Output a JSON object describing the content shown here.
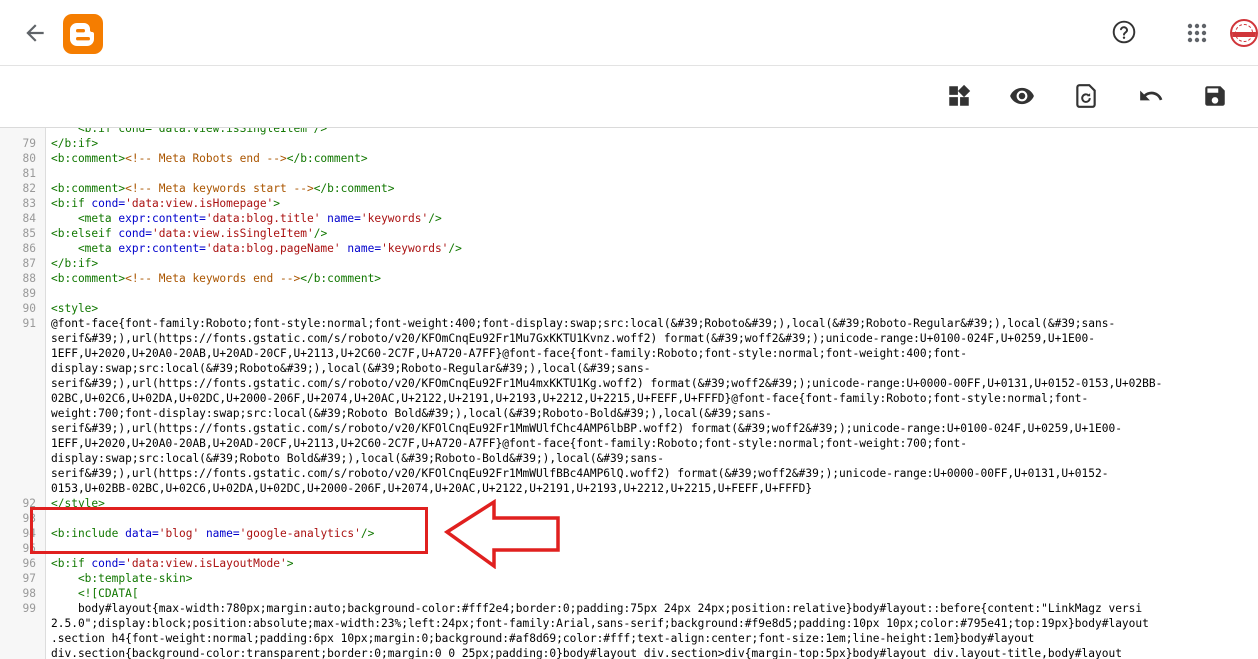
{
  "app": {
    "name": "Blogger",
    "brand_color": "#f57d00"
  },
  "header": {
    "back_icon": "arrow-left-icon",
    "help_icon": "help-circle-icon",
    "apps_icon": "apps-grid-icon",
    "avatar": "user-avatar"
  },
  "toolbar": {
    "buttons": [
      {
        "name": "jump-to-widget",
        "icon": "widgets-icon"
      },
      {
        "name": "preview-theme",
        "icon": "eye-icon"
      },
      {
        "name": "restore-theme",
        "icon": "restore-icon"
      },
      {
        "name": "undo",
        "icon": "undo-icon"
      },
      {
        "name": "save-theme",
        "icon": "save-icon"
      }
    ]
  },
  "highlight_color": "#e0201f",
  "code_lines": [
    {
      "n": "",
      "segs": [
        [
          "tag",
          "    <b:if cond='data:view.isSingleItem'/>"
        ]
      ]
    },
    {
      "n": "79",
      "segs": [
        [
          "tag",
          "</b:if>"
        ]
      ]
    },
    {
      "n": "80",
      "segs": [
        [
          "tag",
          "<b:comment>"
        ],
        [
          "com",
          "<!-- Meta Robots end -->"
        ],
        [
          "tag",
          "</b:comment>"
        ]
      ]
    },
    {
      "n": "81",
      "segs": [
        [
          "txt",
          ""
        ]
      ]
    },
    {
      "n": "82",
      "segs": [
        [
          "tag",
          "<b:comment>"
        ],
        [
          "com",
          "<!-- Meta keywords start -->"
        ],
        [
          "tag",
          "</b:comment>"
        ]
      ]
    },
    {
      "n": "83",
      "segs": [
        [
          "tag",
          "<b:if "
        ],
        [
          "attr",
          "cond="
        ],
        [
          "str",
          "'data:view.isHomepage'"
        ],
        [
          "tag",
          ">"
        ]
      ]
    },
    {
      "n": "84",
      "segs": [
        [
          "tag",
          "    <meta "
        ],
        [
          "attr",
          "expr:content="
        ],
        [
          "str",
          "'data:blog.title'"
        ],
        [
          "attr",
          " name="
        ],
        [
          "str",
          "'keywords'"
        ],
        [
          "tag",
          "/>"
        ]
      ]
    },
    {
      "n": "85",
      "segs": [
        [
          "tag",
          "<b:elseif "
        ],
        [
          "attr",
          "cond="
        ],
        [
          "str",
          "'data:view.isSingleItem'"
        ],
        [
          "tag",
          "/>"
        ]
      ]
    },
    {
      "n": "86",
      "segs": [
        [
          "tag",
          "    <meta "
        ],
        [
          "attr",
          "expr:content="
        ],
        [
          "str",
          "'data:blog.pageName'"
        ],
        [
          "attr",
          " name="
        ],
        [
          "str",
          "'keywords'"
        ],
        [
          "tag",
          "/>"
        ]
      ]
    },
    {
      "n": "87",
      "segs": [
        [
          "tag",
          "</b:if>"
        ]
      ]
    },
    {
      "n": "88",
      "segs": [
        [
          "tag",
          "<b:comment>"
        ],
        [
          "com",
          "<!-- Meta keywords end -->"
        ],
        [
          "tag",
          "</b:comment>"
        ]
      ]
    },
    {
      "n": "89",
      "segs": [
        [
          "txt",
          ""
        ]
      ]
    },
    {
      "n": "90",
      "segs": [
        [
          "tag",
          "<style>"
        ]
      ]
    },
    {
      "n": "91",
      "segs": [
        [
          "txt",
          "@font-face{font-family:Roboto;font-style:normal;font-weight:400;font-display:swap;src:local(&#39;Roboto&#39;),local(&#39;Roboto-Regular&#39;),local(&#39;sans-"
        ]
      ]
    },
    {
      "n": "",
      "segs": [
        [
          "txt",
          "serif&#39;),url(https://fonts.gstatic.com/s/roboto/v20/KFOmCnqEu92Fr1Mu7GxKKTU1Kvnz.woff2) format(&#39;woff2&#39;);unicode-range:U+0100-024F,U+0259,U+1E00-"
        ]
      ]
    },
    {
      "n": "",
      "segs": [
        [
          "txt",
          "1EFF,U+2020,U+20A0-20AB,U+20AD-20CF,U+2113,U+2C60-2C7F,U+A720-A7FF}@font-face{font-family:Roboto;font-style:normal;font-weight:400;font-"
        ]
      ]
    },
    {
      "n": "",
      "segs": [
        [
          "txt",
          "display:swap;src:local(&#39;Roboto&#39;),local(&#39;Roboto-Regular&#39;),local(&#39;sans-"
        ]
      ]
    },
    {
      "n": "",
      "segs": [
        [
          "txt",
          "serif&#39;),url(https://fonts.gstatic.com/s/roboto/v20/KFOmCnqEu92Fr1Mu4mxKKTU1Kg.woff2) format(&#39;woff2&#39;);unicode-range:U+0000-00FF,U+0131,U+0152-0153,U+02BB-"
        ]
      ]
    },
    {
      "n": "",
      "segs": [
        [
          "txt",
          "02BC,U+02C6,U+02DA,U+02DC,U+2000-206F,U+2074,U+20AC,U+2122,U+2191,U+2193,U+2212,U+2215,U+FEFF,U+FFFD}@font-face{font-family:Roboto;font-style:normal;font-"
        ]
      ]
    },
    {
      "n": "",
      "segs": [
        [
          "txt",
          "weight:700;font-display:swap;src:local(&#39;Roboto Bold&#39;),local(&#39;Roboto-Bold&#39;),local(&#39;sans-"
        ]
      ]
    },
    {
      "n": "",
      "segs": [
        [
          "txt",
          "serif&#39;),url(https://fonts.gstatic.com/s/roboto/v20/KFOlCnqEu92Fr1MmWUlfChc4AMP6lbBP.woff2) format(&#39;woff2&#39;);unicode-range:U+0100-024F,U+0259,U+1E00-"
        ]
      ]
    },
    {
      "n": "",
      "segs": [
        [
          "txt",
          "1EFF,U+2020,U+20A0-20AB,U+20AD-20CF,U+2113,U+2C60-2C7F,U+A720-A7FF}@font-face{font-family:Roboto;font-style:normal;font-weight:700;font-"
        ]
      ]
    },
    {
      "n": "",
      "segs": [
        [
          "txt",
          "display:swap;src:local(&#39;Roboto Bold&#39;),local(&#39;Roboto-Bold&#39;),local(&#39;sans-"
        ]
      ]
    },
    {
      "n": "",
      "segs": [
        [
          "txt",
          "serif&#39;),url(https://fonts.gstatic.com/s/roboto/v20/KFOlCnqEu92Fr1MmWUlfBBc4AMP6lQ.woff2) format(&#39;woff2&#39;);unicode-range:U+0000-00FF,U+0131,U+0152-"
        ]
      ]
    },
    {
      "n": "",
      "segs": [
        [
          "txt",
          "0153,U+02BB-02BC,U+02C6,U+02DA,U+02DC,U+2000-206F,U+2074,U+20AC,U+2122,U+2191,U+2193,U+2212,U+2215,U+FEFF,U+FFFD}"
        ]
      ]
    },
    {
      "n": "92",
      "segs": [
        [
          "tag",
          "</style>"
        ]
      ]
    },
    {
      "n": "93",
      "segs": [
        [
          "txt",
          ""
        ]
      ]
    },
    {
      "n": "94",
      "segs": [
        [
          "tag",
          "<b:include "
        ],
        [
          "attr",
          "data="
        ],
        [
          "str",
          "'blog'"
        ],
        [
          "attr",
          " name="
        ],
        [
          "str",
          "'google-analytics'"
        ],
        [
          "tag",
          "/>"
        ]
      ]
    },
    {
      "n": "95",
      "segs": [
        [
          "txt",
          ""
        ]
      ]
    },
    {
      "n": "96",
      "segs": [
        [
          "tag",
          "<b:if "
        ],
        [
          "attr",
          "cond="
        ],
        [
          "str",
          "'data:view.isLayoutMode'"
        ],
        [
          "tag",
          ">"
        ]
      ]
    },
    {
      "n": "97",
      "segs": [
        [
          "tag",
          "    <b:template-skin>"
        ]
      ]
    },
    {
      "n": "98",
      "segs": [
        [
          "tag",
          "    <![CDATA["
        ]
      ]
    },
    {
      "n": "99",
      "segs": [
        [
          "txt",
          "    body#layout{max-width:780px;margin:auto;background-color:#fff2e4;border:0;padding:75px 24px 24px;position:relative}body#layout::before{content:\"LinkMagz versi"
        ]
      ]
    },
    {
      "n": "",
      "segs": [
        [
          "txt",
          "2.5.0\";display:block;position:absolute;max-width:23%;left:24px;font-family:Arial,sans-serif;background:#f9e8d5;padding:10px 10px;color:#795e41;top:19px}body#layout"
        ]
      ]
    },
    {
      "n": "",
      "segs": [
        [
          "txt",
          ".section h4{font-weight:normal;padding:6px 10px;margin:0;background:#af8d69;color:#fff;text-align:center;font-size:1em;line-height:1em}body#layout"
        ]
      ]
    },
    {
      "n": "",
      "segs": [
        [
          "txt",
          "div.section{background-color:transparent;border:0;margin:0 0 25px;padding:0}body#layout div.section>div{margin-top:5px}body#layout div.layout-title,body#layout"
        ]
      ]
    }
  ]
}
